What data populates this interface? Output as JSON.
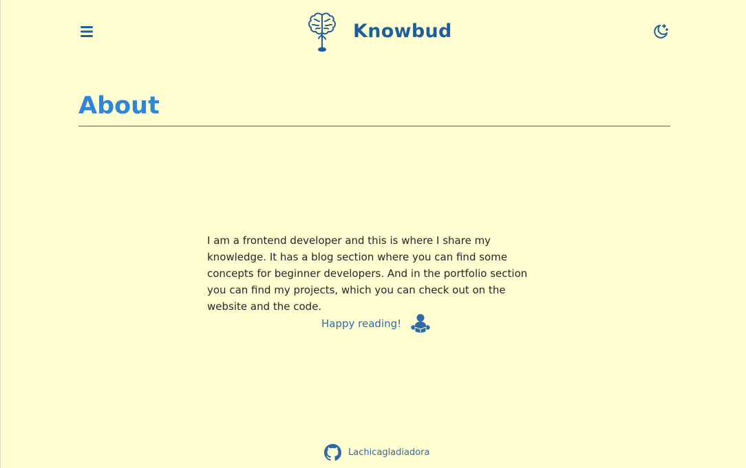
{
  "header": {
    "brand": "Knowbud",
    "menu_icon": "hamburger-menu-icon",
    "logo_icon": "brain-tree-icon",
    "theme_icon": "moon-icon"
  },
  "main": {
    "title": "About",
    "paragraph": "I am a frontend developer and this is where I share my knowledge. It has a blog section where you can find some concepts for beginner developers. And in the portfolio section you can find my projects, which you can check out on the website and the code.",
    "happy_text": "Happy reading!",
    "happy_icon": "person-reading-icon"
  },
  "footer": {
    "link_text": "Lachicagladiadora",
    "link_icon": "github-icon"
  },
  "colors": {
    "background": "#ffffd2",
    "brand": "#1e5f9b",
    "title": "#2f86d6",
    "link": "#2f6aa8",
    "text": "#25252b"
  }
}
